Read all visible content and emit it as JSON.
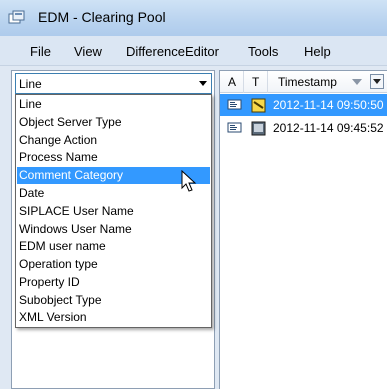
{
  "window": {
    "title": "EDM - Clearing Pool",
    "icon": "edm-app-icon"
  },
  "menu": [
    "File",
    "View",
    "DifferenceEditor",
    "Tools",
    "Help"
  ],
  "combo": {
    "value": "Line"
  },
  "dropdown": {
    "items": [
      "Line",
      "Object Server Type",
      "Change Action",
      "Process Name",
      "Comment Category",
      "Date",
      "SIPLACE User Name",
      "Windows User Name",
      "EDM user name",
      "Operation type",
      "Property ID",
      "Subobject Type",
      "XML Version"
    ],
    "selected_index": 4
  },
  "grid": {
    "columns": [
      "A",
      "T",
      "Timestamp"
    ],
    "rows": [
      {
        "timestamp": "2012-11-14 09:50:50",
        "selected": true
      },
      {
        "timestamp": "2012-11-14 09:45:52",
        "selected": false
      }
    ]
  },
  "colors": {
    "selection": "#3399ff",
    "titlebar": "#b9d3ef",
    "menubar": "#dbe6f3"
  }
}
